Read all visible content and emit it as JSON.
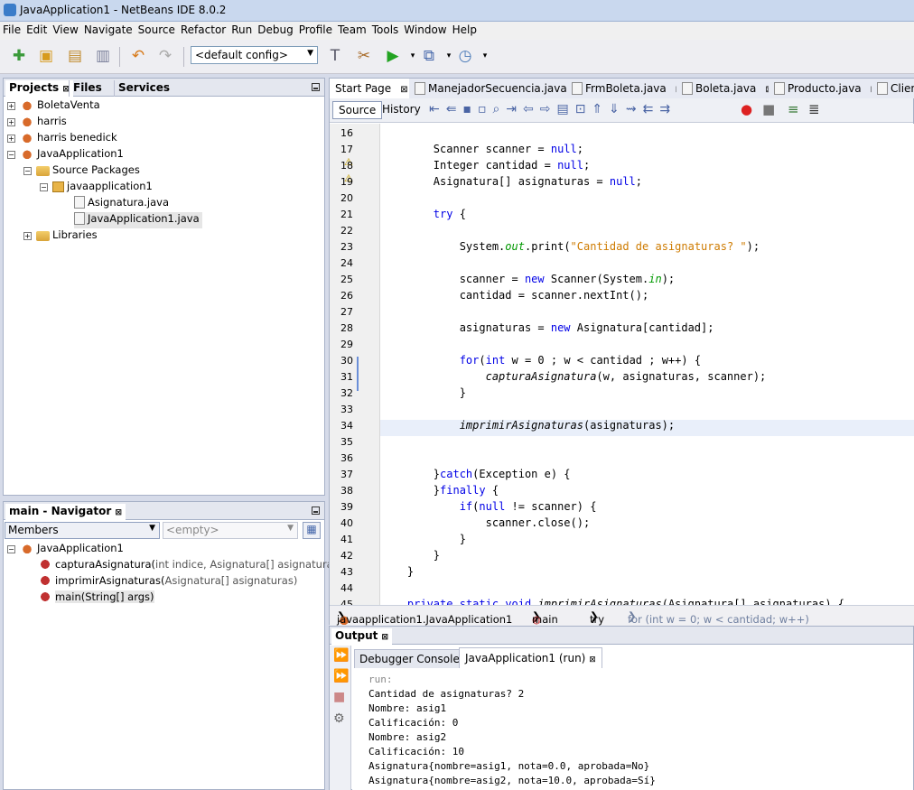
{
  "window": {
    "title": "JavaApplication1 - NetBeans IDE 8.0.2"
  },
  "menu": [
    "File",
    "Edit",
    "View",
    "Navigate",
    "Source",
    "Refactor",
    "Run",
    "Debug",
    "Profile",
    "Team",
    "Tools",
    "Window",
    "Help"
  ],
  "toolbar": {
    "config": "<default config>"
  },
  "projects": {
    "tabs": [
      "Projects",
      "Files",
      "Services"
    ],
    "tree": [
      {
        "label": "BoletaVenta",
        "level": 0,
        "icon": "cup"
      },
      {
        "label": "harris",
        "level": 0,
        "icon": "cup"
      },
      {
        "label": "harris benedick",
        "level": 0,
        "icon": "cup"
      },
      {
        "label": "JavaApplication1",
        "level": 0,
        "icon": "cup"
      },
      {
        "label": "Source Packages",
        "level": 1,
        "icon": "folder"
      },
      {
        "label": "javaapplication1",
        "level": 2,
        "icon": "pkg"
      },
      {
        "label": "Asignatura.java",
        "level": 3,
        "icon": "file"
      },
      {
        "label": "JavaApplication1.java",
        "level": 3,
        "icon": "file"
      },
      {
        "label": "Libraries",
        "level": 1,
        "icon": "folder"
      }
    ]
  },
  "navigator": {
    "title": "main - Navigator",
    "filter": "Members",
    "empty": "<empty>",
    "root": "JavaApplication1",
    "items": [
      {
        "name": "capturaAsignatura(",
        "params": "int indice, Asignatura[] asignaturas, Scann"
      },
      {
        "name": "imprimirAsignaturas(",
        "params": "Asignatura[] asignaturas)"
      },
      {
        "name": "main(String[] args)",
        "params": ""
      }
    ]
  },
  "editor": {
    "tabs": [
      "Start Page",
      "ManejadorSecuencia.java",
      "FrmBoleta.java",
      "Boleta.java",
      "Producto.java",
      "Client"
    ],
    "subtabs": [
      "Source",
      "History"
    ],
    "lines": [
      {
        "n": "16",
        "t": ""
      },
      {
        "n": "17",
        "t": "        Scanner scanner = null;"
      },
      {
        "n": "18",
        "t": "        Integer cantidad = null;"
      },
      {
        "n": "19",
        "t": "        Asignatura[] asignaturas = null;"
      },
      {
        "n": "20",
        "t": ""
      },
      {
        "n": "21",
        "t": "        try {"
      },
      {
        "n": "22",
        "t": ""
      },
      {
        "n": "23",
        "t": "            System.out.print(\"Cantidad de asignaturas? \");"
      },
      {
        "n": "24",
        "t": ""
      },
      {
        "n": "25",
        "t": "            scanner = new Scanner(System.in);"
      },
      {
        "n": "26",
        "t": "            cantidad = scanner.nextInt();"
      },
      {
        "n": "27",
        "t": ""
      },
      {
        "n": "28",
        "t": "            asignaturas = new Asignatura[cantidad];"
      },
      {
        "n": "29",
        "t": ""
      },
      {
        "n": "30",
        "t": "            for(int w = 0 ; w < cantidad ; w++) {"
      },
      {
        "n": "31",
        "t": "                capturaAsignatura(w, asignaturas, scanner);"
      },
      {
        "n": "32",
        "t": "            }"
      },
      {
        "n": "33",
        "t": ""
      },
      {
        "n": "34",
        "t": "            imprimirAsignaturas(asignaturas);"
      },
      {
        "n": "35",
        "t": ""
      },
      {
        "n": "36",
        "t": ""
      },
      {
        "n": "37",
        "t": "        }catch(Exception e) {"
      },
      {
        "n": "38",
        "t": "        }finally {"
      },
      {
        "n": "39",
        "t": "            if(null != scanner) {"
      },
      {
        "n": "40",
        "t": "                scanner.close();"
      },
      {
        "n": "41",
        "t": "            }"
      },
      {
        "n": "42",
        "t": "        }"
      },
      {
        "n": "43",
        "t": "    }"
      },
      {
        "n": "44",
        "t": ""
      },
      {
        "n": "45",
        "t": "    private static void imprimirAsignaturas(Asignatura[] asignaturas) {"
      }
    ],
    "breadcrumb": [
      "javaapplication1.JavaApplication1",
      "main",
      "try",
      "for (int w = 0; w < cantidad; w++)"
    ]
  },
  "output": {
    "title": "Output",
    "tabs": [
      "Debugger Console",
      "JavaApplication1 (run)"
    ],
    "lines": [
      "run:",
      "Cantidad de asignaturas? 2",
      "Nombre: asig1",
      "Calificación: 0",
      "Nombre: asig2",
      "Calificación: 10",
      "Asignatura{nombre=asig1, nota=0.0, aprobada=No}",
      "Asignatura{nombre=asig2, nota=10.0, aprobada=Sí}"
    ]
  }
}
